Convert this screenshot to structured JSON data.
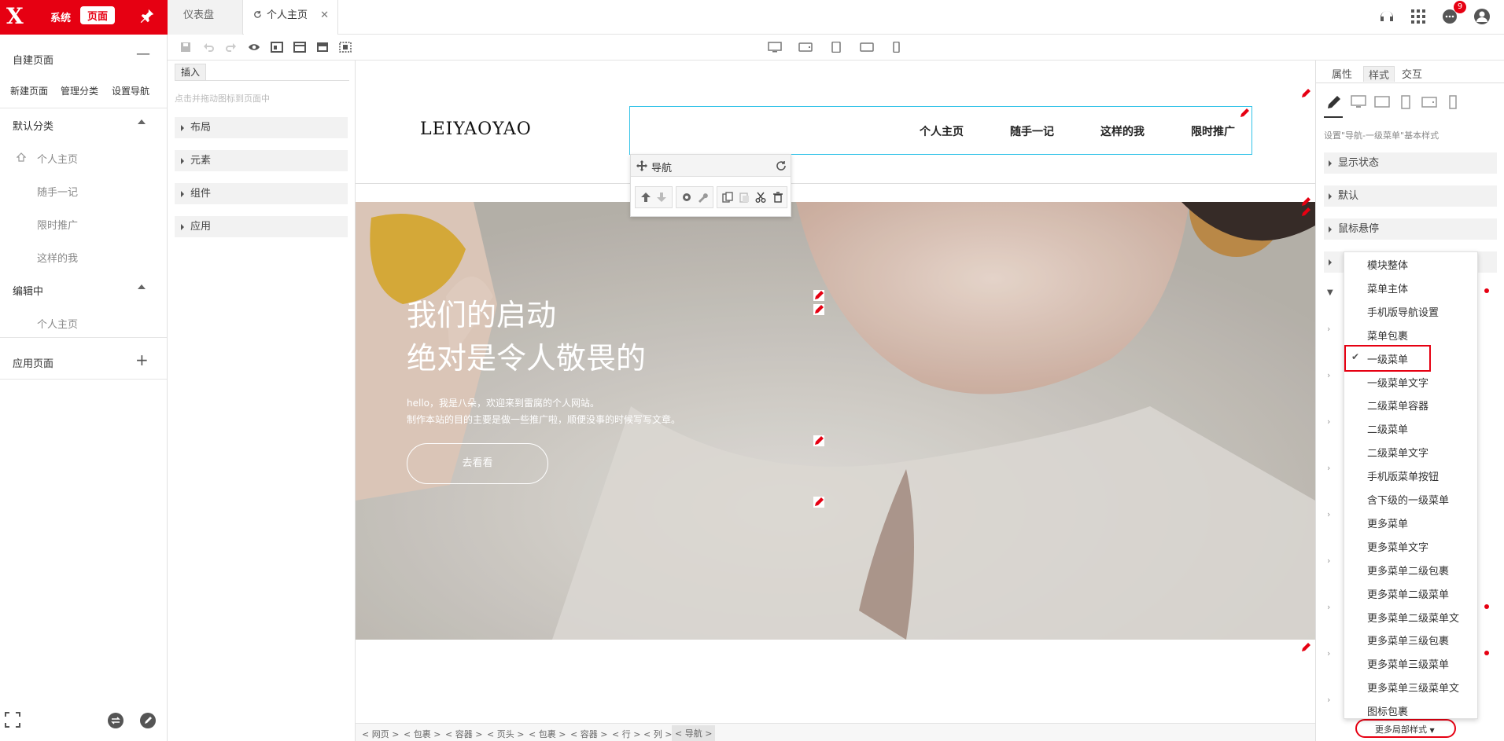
{
  "brand": {
    "logo": "X",
    "system": "系统",
    "page": "页面"
  },
  "tabs": [
    {
      "label": "仪表盘"
    },
    {
      "label": "个人主页"
    }
  ],
  "notifications": {
    "count": "9"
  },
  "left_nav": {
    "custom_pages": "自建页面",
    "buttons": [
      "新建页面",
      "管理分类",
      "设置导航"
    ],
    "default_category": "默认分类",
    "default_items": [
      "个人主页",
      "随手一记",
      "限时推广",
      "这样的我"
    ],
    "editing": "编辑中",
    "editing_items": [
      "个人主页"
    ],
    "app_pages": "应用页面"
  },
  "insert_panel": {
    "tab": "插入",
    "hint": "点击并拖动图标到页面中",
    "sections": [
      "布局",
      "元素",
      "组件",
      "应用"
    ]
  },
  "site": {
    "logo": "LEIYAOYAO",
    "nav": [
      "个人主页",
      "随手一记",
      "这样的我",
      "限时推广"
    ],
    "hero_title1": "我们的启动",
    "hero_title2": "绝对是令人敬畏的",
    "hero_text1": "hello，我是八朵，欢迎来到雷腐的个人网站。",
    "hero_text2": "制作本站的目的主要是做一些推广啦，顺便没事的时候写写文章。",
    "hero_button": "去看看"
  },
  "nav_toolbar": {
    "title": "导航"
  },
  "breadcrumbs": [
    "< 网页 >",
    "< 包裹 >",
    "< 容器 >",
    "< 页头 >",
    "< 包裹 >",
    "< 容器 >",
    "< 行 >",
    "< 列 >",
    "< 导航 >"
  ],
  "right_panel": {
    "tabs": [
      "属性",
      "样式",
      "交互"
    ],
    "description": "设置\"导航-一级菜单\"基本样式",
    "sections": [
      "显示状态",
      "默认",
      "鼠标悬停"
    ],
    "more_button": "更多局部样式"
  },
  "dropdown": {
    "items": [
      "模块整体",
      "菜单主体",
      "手机版导航设置",
      "菜单包裹",
      "一级菜单",
      "一级菜单文字",
      "二级菜单容器",
      "二级菜单",
      "二级菜单文字",
      "手机版菜单按钮",
      "含下级的一级菜单",
      "更多菜单",
      "更多菜单文字",
      "更多菜单二级包裹",
      "更多菜单二级菜单",
      "更多菜单二级菜单文",
      "更多菜单三级包裹",
      "更多菜单三级菜单",
      "更多菜单三级菜单文",
      "图标包裹"
    ],
    "selected": "一级菜单"
  },
  "colors": {
    "brand": "#e60012",
    "selection": "#33c3e8"
  }
}
